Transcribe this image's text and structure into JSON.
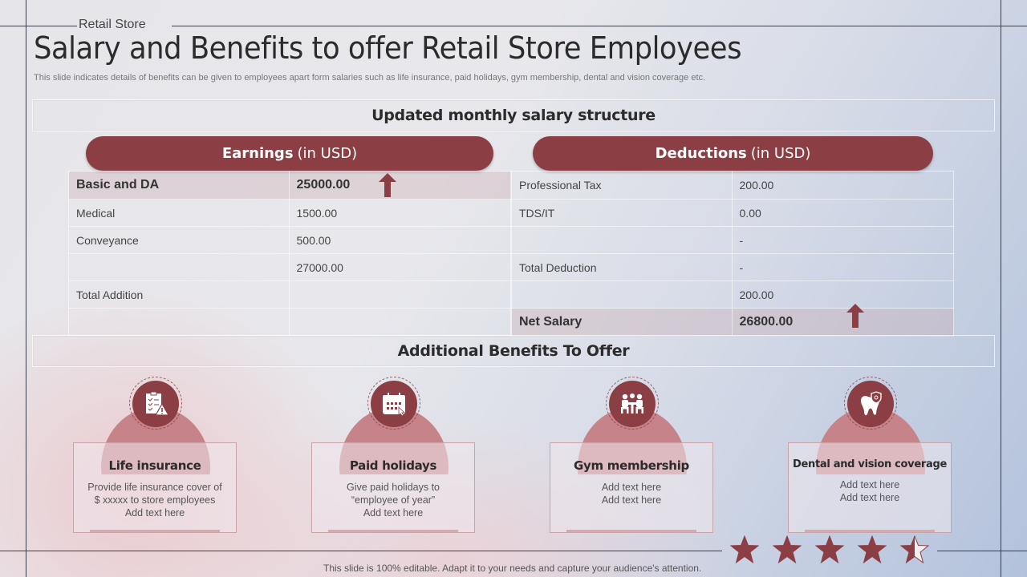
{
  "header": {
    "subtitle": "Retail Store",
    "title": "Salary and Benefits to offer Retail Store Employees",
    "description": "This slide indicates details of benefits can be given to employees apart form salaries such as  life insurance, paid holidays, gym membership, dental and vision coverage etc."
  },
  "salary": {
    "section_title": "Updated monthly salary structure",
    "earnings": {
      "label_bold": "Earnings",
      "label_light": "(in USD)",
      "rows": [
        {
          "item": "Basic and DA",
          "value": "25000.00",
          "highlight": true
        },
        {
          "item": "Medical",
          "value": "1500.00"
        },
        {
          "item": "Conveyance",
          "value": "500.00"
        },
        {
          "item": "",
          "value": "27000.00"
        },
        {
          "item": "Total Addition",
          "value": ""
        },
        {
          "item": "",
          "value": ""
        }
      ]
    },
    "deductions": {
      "label_bold": "Deductions",
      "label_light": "(in USD)",
      "rows": [
        {
          "item": "Professional Tax",
          "value": "200.00"
        },
        {
          "item": "TDS/IT",
          "value": "0.00"
        },
        {
          "item": "",
          "value": "-"
        },
        {
          "item": "Total Deduction",
          "value": "-"
        },
        {
          "item": "",
          "value": "200.00"
        },
        {
          "item": "Net Salary",
          "value": "26800.00",
          "highlight": true
        }
      ]
    },
    "accent_color": "#8b3f45"
  },
  "benefits": {
    "section_title": "Additional Benefits To Offer",
    "items": [
      {
        "title": "Life insurance",
        "icon": "clipboard-warning-icon",
        "lines": [
          "Provide  life insurance cover  of",
          "$ xxxxx to store employees",
          "Add text here"
        ]
      },
      {
        "title": "Paid holidays",
        "icon": "calendar-icon",
        "lines": [
          "Give  paid holidays to",
          "“employee  of year”",
          "Add text here"
        ]
      },
      {
        "title": "Gym membership",
        "icon": "meeting-people-icon",
        "lines": [
          "Add text here",
          "Add text here"
        ]
      },
      {
        "title": "Dental and vision coverage",
        "icon": "tooth-shield-icon",
        "lines": [
          "Add text here",
          "Add text here"
        ]
      }
    ]
  },
  "rating": {
    "value": 4.5,
    "max": 5
  },
  "footer": {
    "note": "This slide is 100% editable. Adapt it to your needs and capture your audience's attention."
  }
}
